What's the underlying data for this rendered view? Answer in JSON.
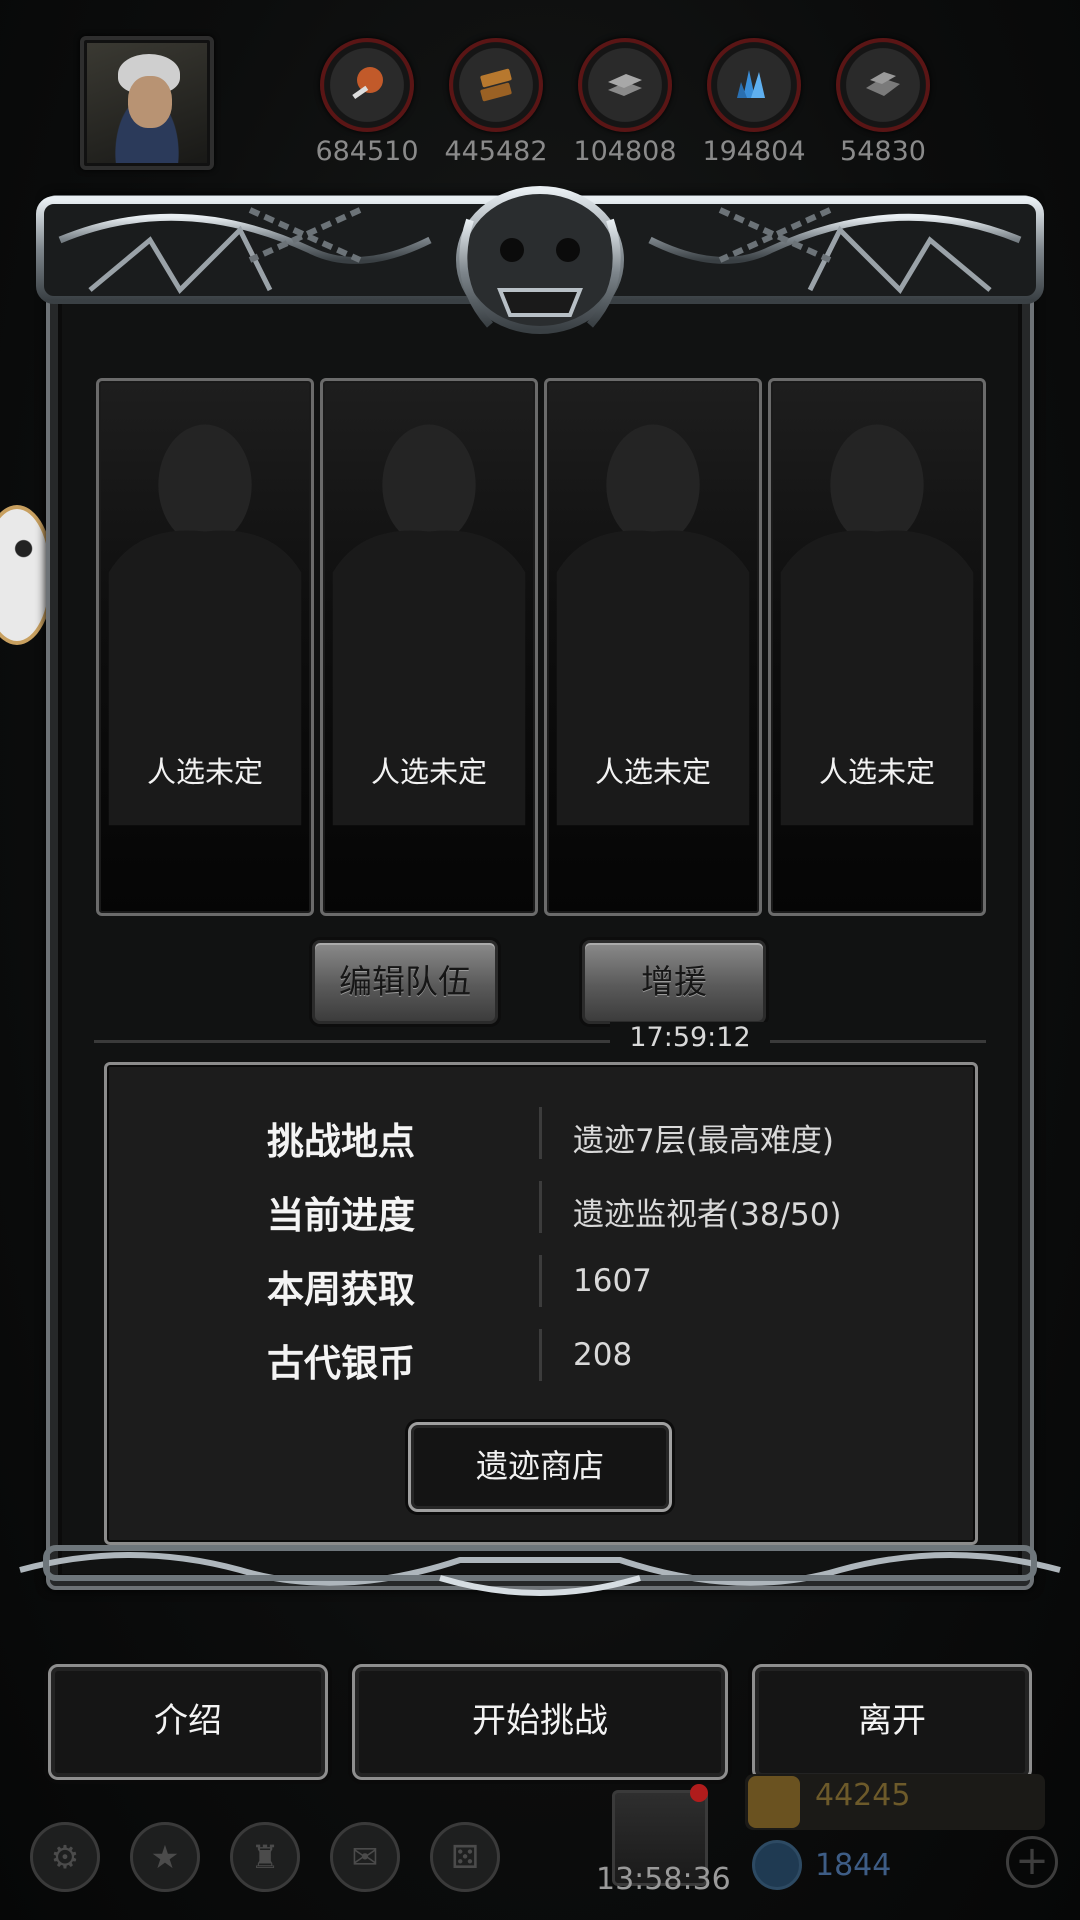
{
  "resources": [
    {
      "icon": "meat-icon",
      "value": "684510",
      "color": "#c25a2a"
    },
    {
      "icon": "wood-icon",
      "value": "445482",
      "color": "#b7782e"
    },
    {
      "icon": "iron-icon",
      "value": "104808",
      "color": "#8a8a8a"
    },
    {
      "icon": "crystal-icon",
      "value": "194804",
      "color": "#3a8ed8"
    },
    {
      "icon": "stone-icon",
      "value": "54830",
      "color": "#7a7a7a"
    }
  ],
  "slots": [
    {
      "label": "人选未定"
    },
    {
      "label": "人选未定"
    },
    {
      "label": "人选未定"
    },
    {
      "label": "人选未定"
    }
  ],
  "team": {
    "edit_label": "编辑队伍",
    "reinforce_label": "增援",
    "timer": "17:59:12"
  },
  "info": {
    "rows": [
      {
        "key": "挑战地点",
        "value": "遗迹7层(最高难度)"
      },
      {
        "key": "当前进度",
        "value": "遗迹监视者(38/50)"
      },
      {
        "key": "本周获取",
        "value": "1607"
      },
      {
        "key": "古代银币",
        "value": "208"
      }
    ],
    "shop_label": "遗迹商店"
  },
  "actions": {
    "intro_label": "介绍",
    "start_label": "开始挑战",
    "leave_label": "离开"
  },
  "footer": {
    "clock": "13:58:36",
    "gold": "44245",
    "gems": "1844"
  }
}
